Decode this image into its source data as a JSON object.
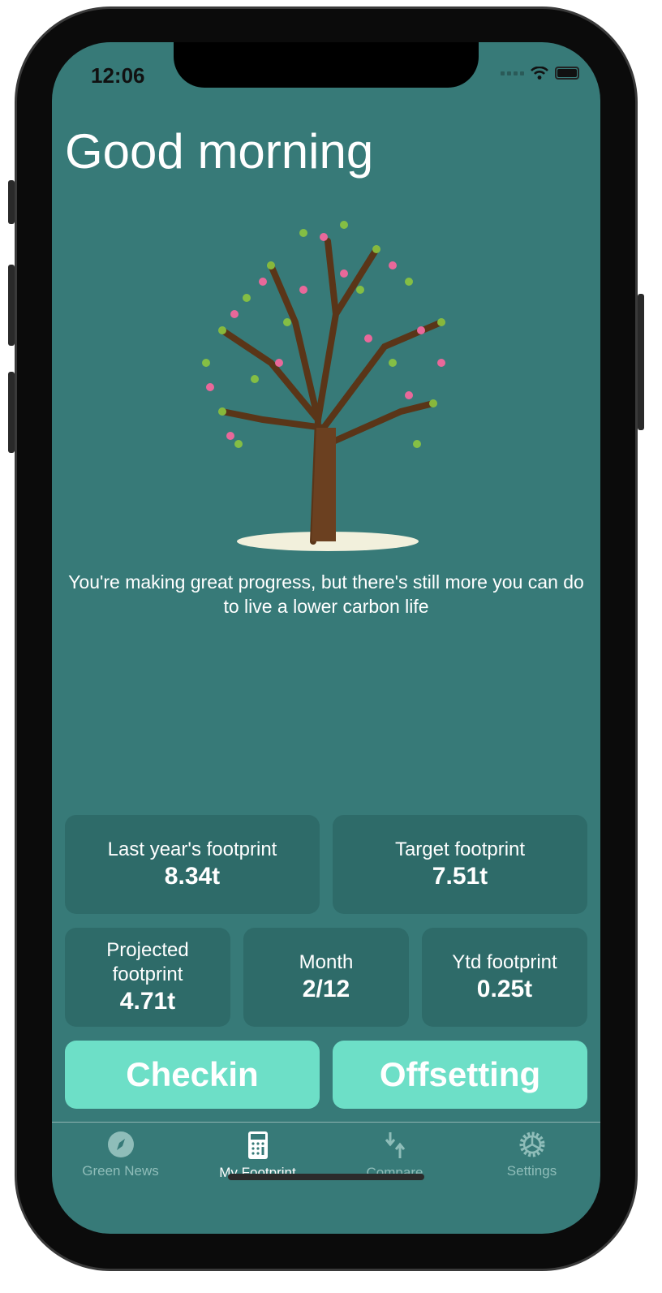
{
  "status": {
    "time": "12:06"
  },
  "header": {
    "greeting": "Good morning"
  },
  "message": "You're making great progress, but there's still more you can do to live a lower carbon life",
  "stats": [
    {
      "label": "Last year's footprint",
      "value": "8.34t"
    },
    {
      "label": "Target footprint",
      "value": "7.51t"
    },
    {
      "label": "Projected footprint",
      "value": "4.71t"
    },
    {
      "label": "Month",
      "value": "2/12"
    },
    {
      "label": "Ytd footprint",
      "value": "0.25t"
    }
  ],
  "actions": {
    "checkin": "Checkin",
    "offsetting": "Offsetting"
  },
  "tabs": [
    {
      "label": "Green News",
      "icon": "compass-icon"
    },
    {
      "label": "My Footprint",
      "icon": "calculator-icon",
      "active": true
    },
    {
      "label": "Compare",
      "icon": "arrows-up-down-icon"
    },
    {
      "label": "Settings",
      "icon": "gear-icon"
    }
  ],
  "colors": {
    "background": "#377a78",
    "card": "#2e6b69",
    "accent": "#6ddfc7"
  }
}
